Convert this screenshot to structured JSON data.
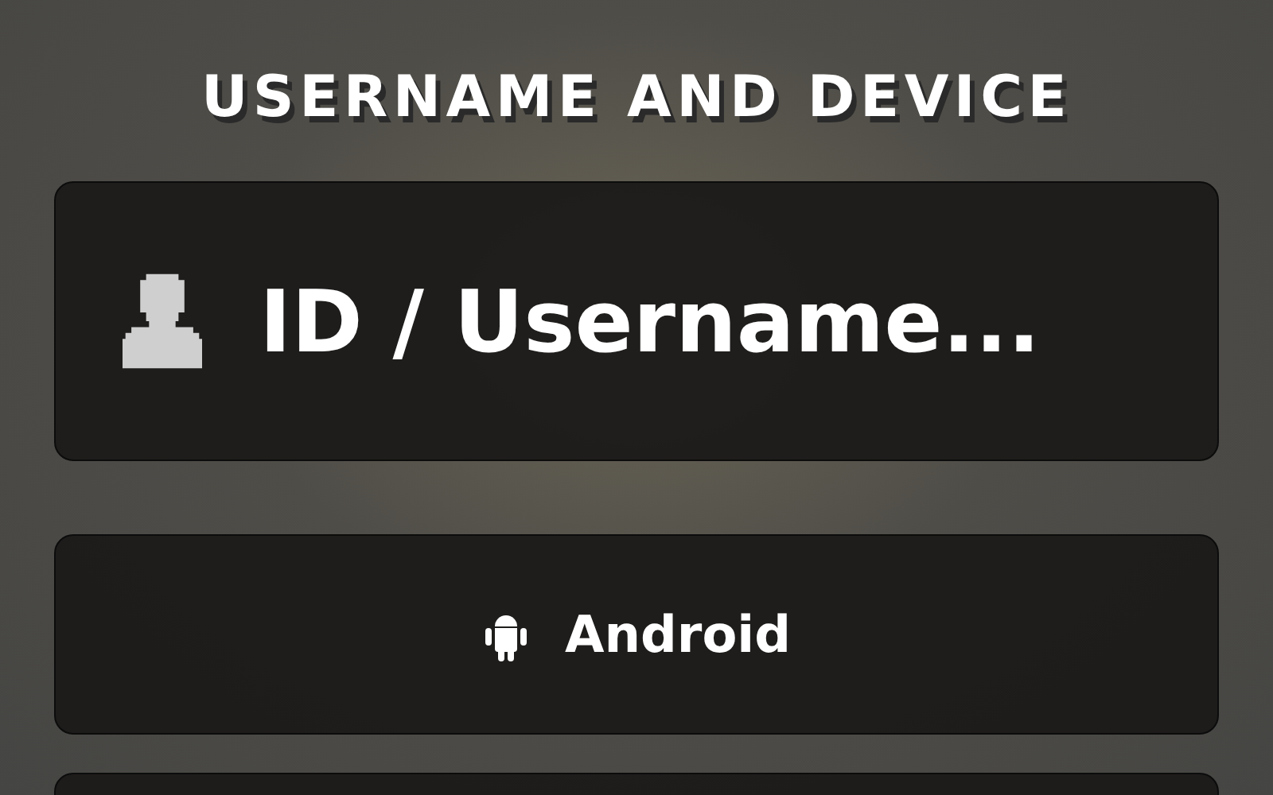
{
  "title": "USERNAME AND DEVICE",
  "username_field": {
    "placeholder": "ID / Username..."
  },
  "option_buttons": [
    {
      "kind": "device",
      "label": "Android"
    },
    {
      "kind": "blank"
    }
  ]
}
